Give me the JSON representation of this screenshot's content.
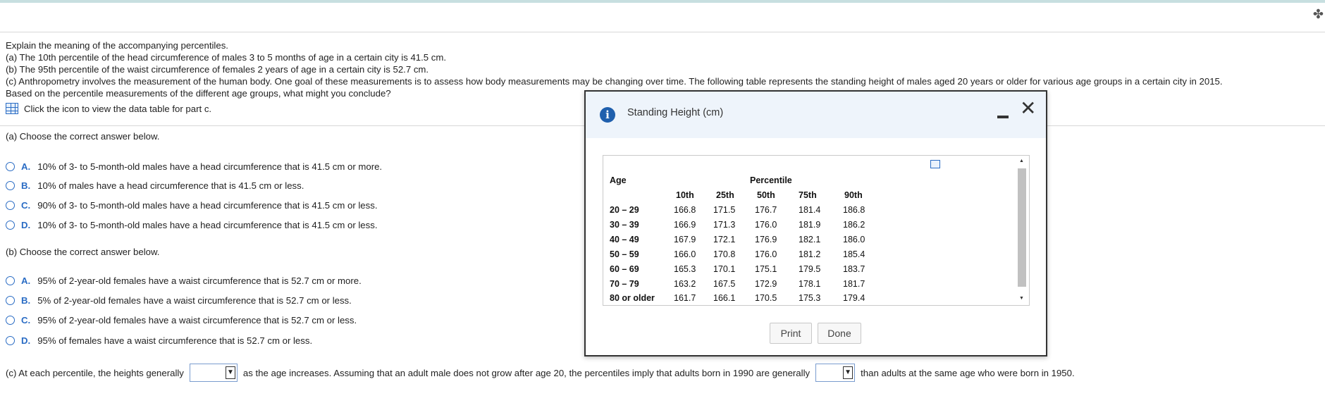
{
  "question": {
    "lines": [
      "Explain the meaning of the accompanying percentiles.",
      "(a) The 10th percentile of the head circumference of males 3 to 5 months of age in a certain city is 41.5 cm.",
      "(b) The 95th percentile of the waist circumference of females 2 years of age in a certain city is 52.7 cm.",
      "(c) Anthropometry involves the measurement of the human body. One goal of these measurements is to assess how body measurements may be changing over time. The following table represents the standing height of males aged 20 years or older for various age groups in a certain city in 2015.",
      "Based on the percentile measurements of the different age groups, what might you conclude?"
    ],
    "table_link": "Click the icon to view the data table for part c."
  },
  "part_a": {
    "prompt": "(a) Choose the correct answer below.",
    "options": [
      {
        "letter": "A.",
        "text": "10% of 3- to 5-month-old males have a head circumference that is 41.5 cm or more."
      },
      {
        "letter": "B.",
        "text": "10% of males have a head circumference that is 41.5 cm or less."
      },
      {
        "letter": "C.",
        "text": "90% of 3- to 5-month-old males have a head circumference that is 41.5 cm or less."
      },
      {
        "letter": "D.",
        "text": "10% of 3- to 5-month-old males have a head circumference that is 41.5 cm or less."
      }
    ]
  },
  "part_b": {
    "prompt": "(b) Choose the correct answer below.",
    "options": [
      {
        "letter": "A.",
        "text": "95% of 2-year-old females have a waist circumference that is 52.7 cm or more."
      },
      {
        "letter": "B.",
        "text": "5% of 2-year-old females have a waist circumference that is 52.7 cm or less."
      },
      {
        "letter": "C.",
        "text": "95% of 2-year-old females have a waist circumference that is 52.7 cm or less."
      },
      {
        "letter": "D.",
        "text": "95% of females have a waist circumference that is 52.7 cm or less."
      }
    ]
  },
  "part_c": {
    "text_1": "(c) At each percentile, the heights generally",
    "text_2": "as the age increases. Assuming that an adult male does not grow after age 20, the percentiles imply that adults born in 1990 are generally",
    "text_3": "than adults at the same age who were born in 1950."
  },
  "dialog": {
    "title": "Standing Height (cm)",
    "table": {
      "age_header": "Age",
      "percentile_header": "Percentile",
      "columns": [
        "10th",
        "25th",
        "50th",
        "75th",
        "90th"
      ],
      "rows": [
        {
          "age": "20 – 29",
          "values": [
            "166.8",
            "171.5",
            "176.7",
            "181.4",
            "186.8"
          ]
        },
        {
          "age": "30 – 39",
          "values": [
            "166.9",
            "171.3",
            "176.0",
            "181.9",
            "186.2"
          ]
        },
        {
          "age": "40 – 49",
          "values": [
            "167.9",
            "172.1",
            "176.9",
            "182.1",
            "186.0"
          ]
        },
        {
          "age": "50 – 59",
          "values": [
            "166.0",
            "170.8",
            "176.0",
            "181.2",
            "185.4"
          ]
        },
        {
          "age": "60 – 69",
          "values": [
            "165.3",
            "170.1",
            "175.1",
            "179.5",
            "183.7"
          ]
        },
        {
          "age": "70 – 79",
          "values": [
            "163.2",
            "167.5",
            "172.9",
            "178.1",
            "181.7"
          ]
        },
        {
          "age": "80 or older",
          "values": [
            "161.7",
            "166.1",
            "170.5",
            "175.3",
            "179.4"
          ]
        }
      ]
    },
    "print_label": "Print",
    "done_label": "Done"
  },
  "colors": {
    "accent": "#2a6cc4",
    "dialog_header": "#eef4fb",
    "info_icon": "#1f5fad"
  }
}
